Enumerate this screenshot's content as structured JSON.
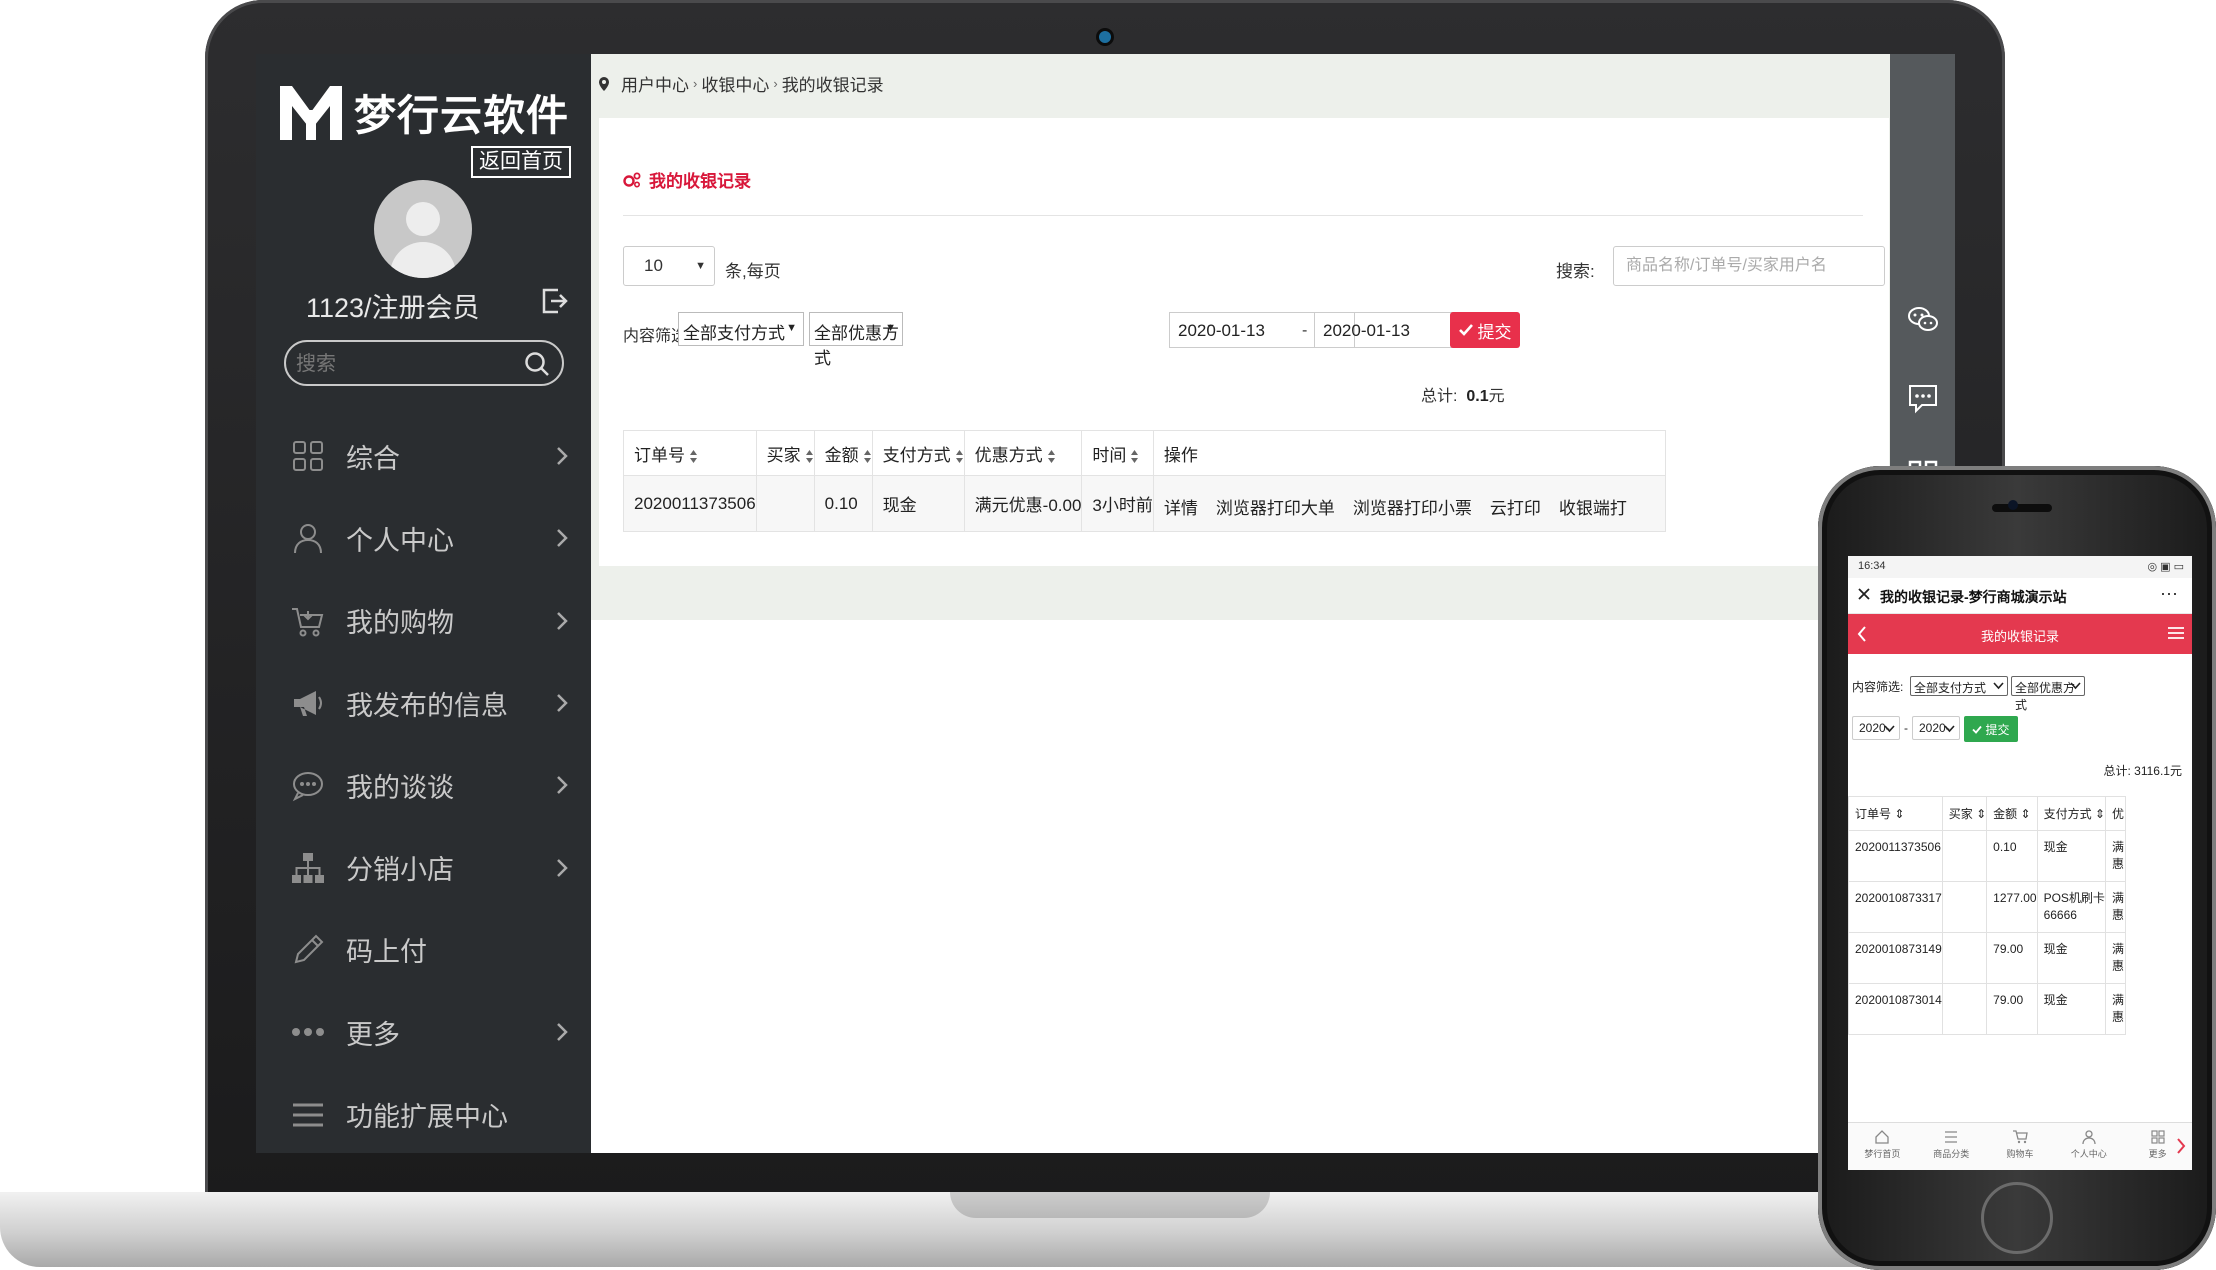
{
  "brand": {
    "name": "梦行云软件",
    "back_home": "返回首页"
  },
  "user": {
    "name": "1123/注册会员"
  },
  "sidebar": {
    "search_placeholder": "搜索",
    "items": [
      {
        "label": "综合",
        "icon": "grid-icon",
        "has_arrow": true
      },
      {
        "label": "个人中心",
        "icon": "user-icon",
        "has_arrow": true
      },
      {
        "label": "我的购物",
        "icon": "cart-icon",
        "has_arrow": true
      },
      {
        "label": "我发布的信息",
        "icon": "megaphone-icon",
        "has_arrow": true
      },
      {
        "label": "我的谈谈",
        "icon": "chat-icon",
        "has_arrow": true
      },
      {
        "label": "分销小店",
        "icon": "hierarchy-icon",
        "has_arrow": true
      },
      {
        "label": "码上付",
        "icon": "pen-icon",
        "has_arrow": false
      },
      {
        "label": "更多",
        "icon": "dots-icon",
        "has_arrow": true
      },
      {
        "label": "功能扩展中心",
        "icon": "list-icon",
        "has_arrow": false
      }
    ]
  },
  "breadcrumb": [
    "用户中心",
    "收银中心",
    "我的收银记录"
  ],
  "page": {
    "title": "我的收银记录",
    "per_page_value": "10",
    "per_page_label": "条,每页",
    "search_label": "搜索:",
    "search_placeholder": "商品名称/订单号/买家用户名",
    "filter_label": "内容筛选:",
    "payment_select": "全部支付方式",
    "discount_select": "全部优惠方式",
    "date_from": "2020-01-13",
    "date_sep": "-",
    "date_to": "2020-01-13",
    "submit": "提交",
    "total_label": "总计:",
    "total_value": "0.1",
    "total_unit": "元"
  },
  "table": {
    "headers": [
      "订单号",
      "买家",
      "金额",
      "支付方式",
      "优惠方式",
      "时间",
      "操作"
    ],
    "rows": [
      {
        "order": "2020011373506",
        "buyer": "",
        "amount": "0.10",
        "pay": "现金",
        "discount": "满元优惠-0.00",
        "time": "3小时前",
        "ops": [
          "详情",
          "浏览器打印大单",
          "浏览器打印小票",
          "云打印",
          "收银端打"
        ]
      }
    ]
  },
  "phone": {
    "status_time": "16:34",
    "status_right": "◎ ▣ ▭",
    "title": "我的收银记录-梦行商城演示站",
    "more": "···",
    "header": "我的收银记录",
    "filter_label": "内容筛选:",
    "payment_select": "全部支付方式",
    "discount_select": "全部优惠方式",
    "date_from": "2020-",
    "date_sep": "-",
    "date_to": "2020-",
    "submit": "提交",
    "total_label": "总计:",
    "total_value": "3116.1元",
    "headers": [
      "订单号",
      "买家",
      "金额",
      "支付方式",
      "优"
    ],
    "rows": [
      {
        "order": "2020011373506",
        "buyer": "",
        "amount": "0.10",
        "pay": "现金",
        "extra": "满惠"
      },
      {
        "order": "2020010873317",
        "buyer": "",
        "amount": "1277.00",
        "pay": "POS机刷卡66666",
        "extra": "满惠"
      },
      {
        "order": "2020010873149",
        "buyer": "",
        "amount": "79.00",
        "pay": "现金",
        "extra": "满惠"
      },
      {
        "order": "2020010873014",
        "buyer": "",
        "amount": "79.00",
        "pay": "现金",
        "extra": "满惠"
      }
    ],
    "nav": [
      "梦行首页",
      "商品分类",
      "购物车",
      "个人中心",
      "更多"
    ]
  }
}
